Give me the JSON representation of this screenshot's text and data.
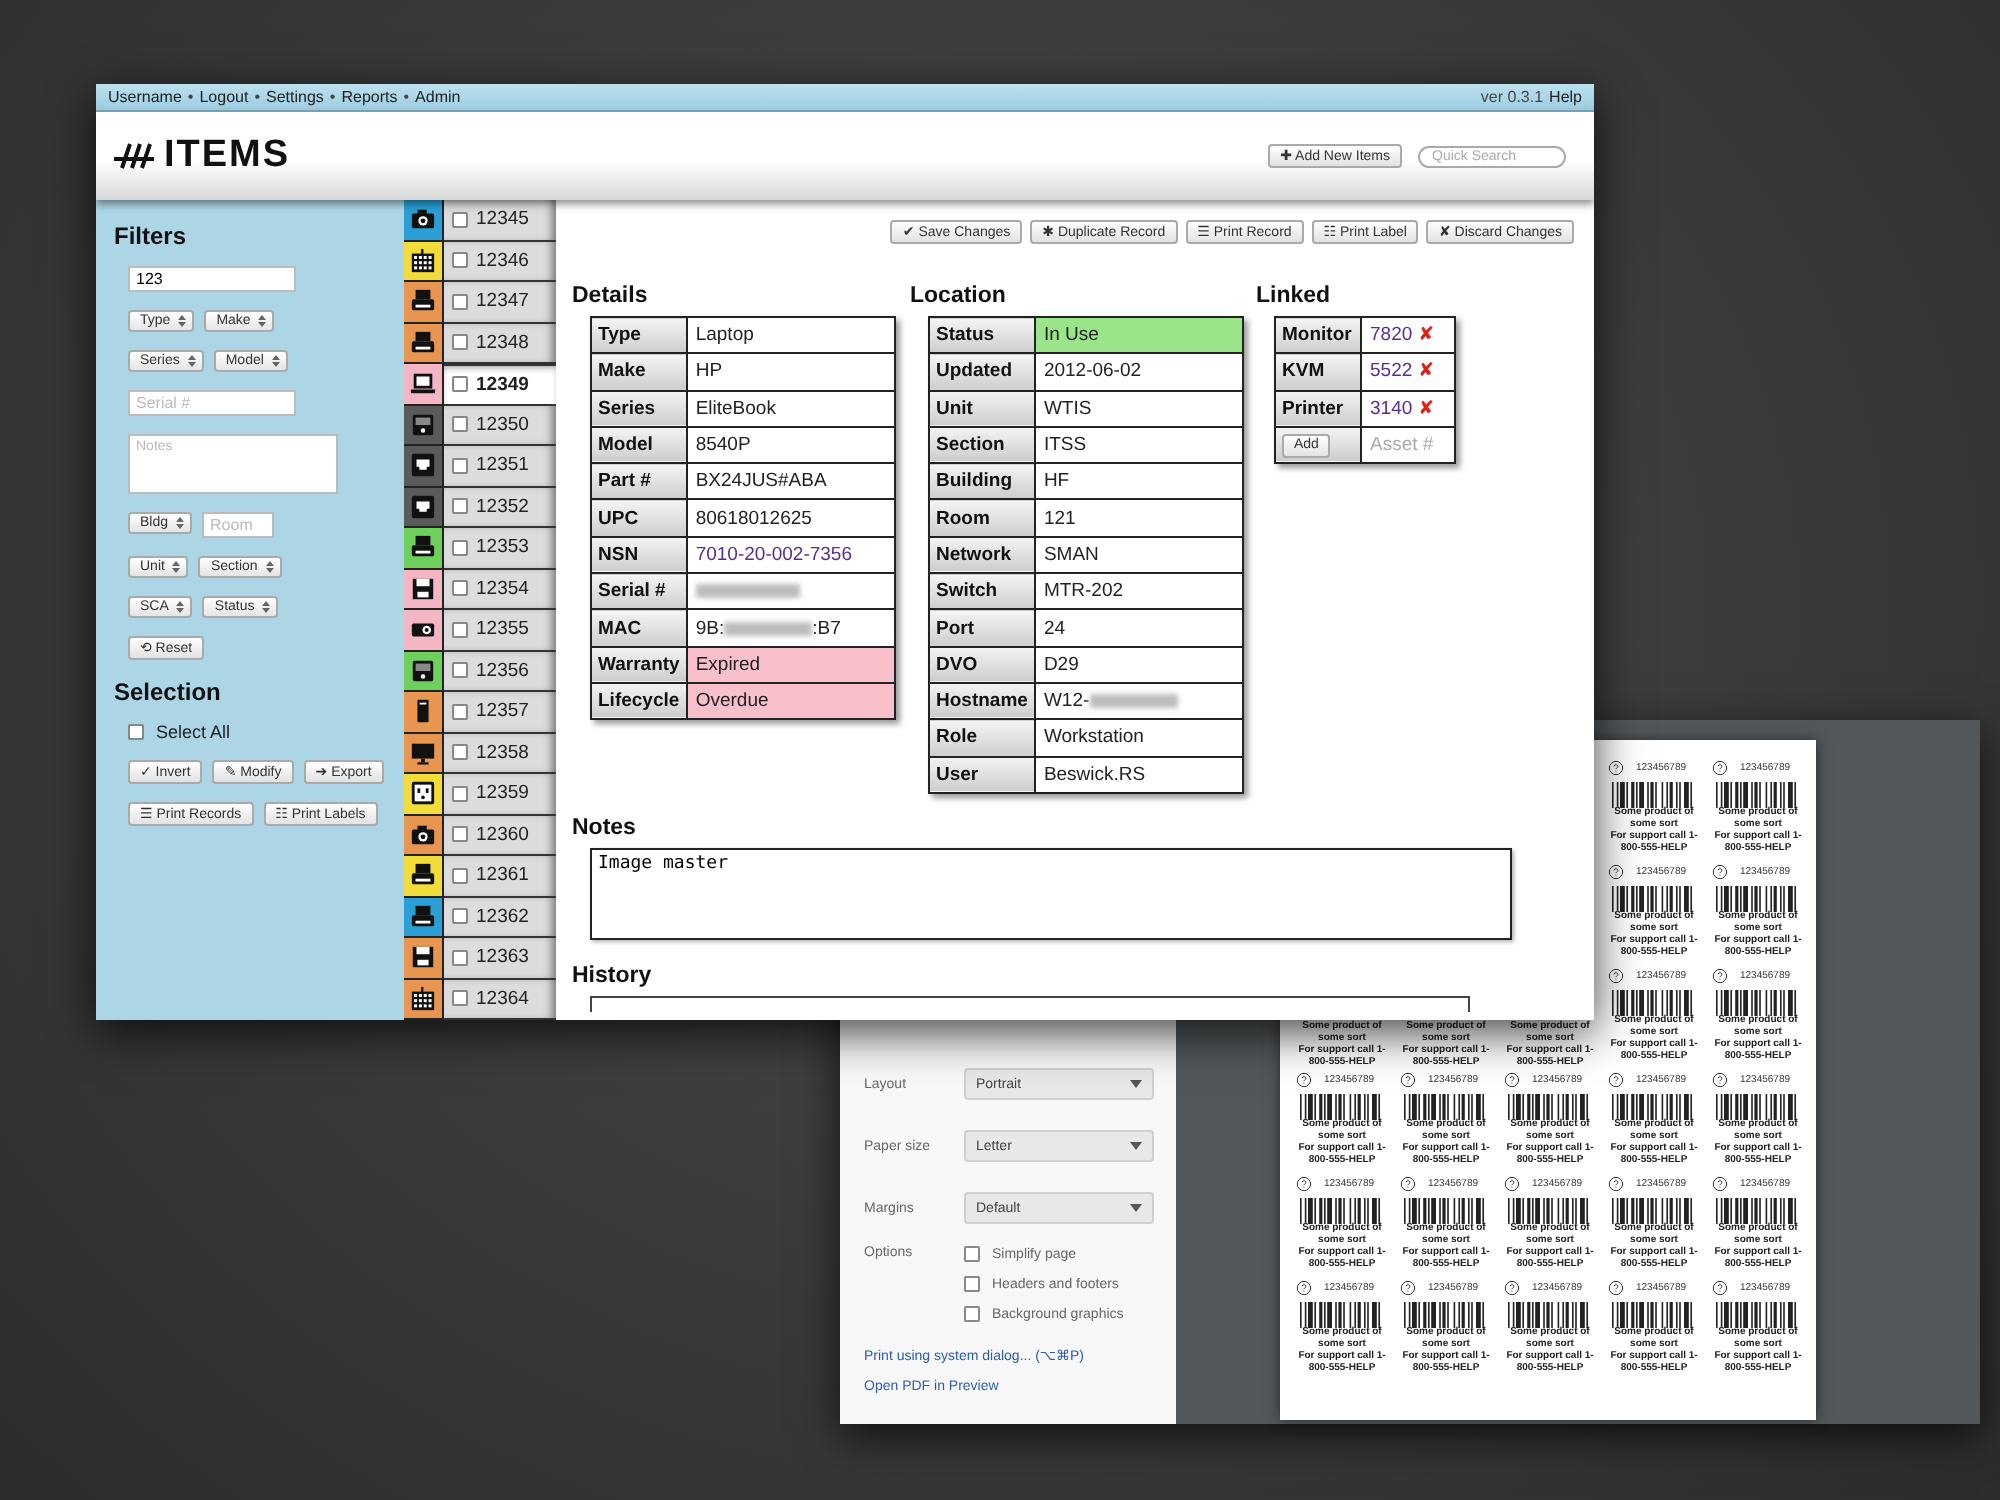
{
  "top_bar": {
    "nav": [
      {
        "kind": "link",
        "text": "Username"
      },
      {
        "kind": "separator",
        "text": "•"
      },
      {
        "kind": "link",
        "text": "Logout"
      },
      {
        "kind": "separator",
        "text": "•"
      },
      {
        "kind": "link",
        "text": "Settings"
      },
      {
        "kind": "separator",
        "text": "•"
      },
      {
        "kind": "link",
        "text": "Reports"
      },
      {
        "kind": "separator",
        "text": "•"
      },
      {
        "kind": "link",
        "text": "Admin"
      }
    ],
    "version": "ver 0.3.1",
    "help": "Help"
  },
  "header": {
    "logo": "ITEMS",
    "add_button": "✚ Add New Items",
    "search": {
      "placeholder": "Quick Search"
    }
  },
  "filters": {
    "title": "Filters",
    "rows": [
      [
        {
          "kind": "input",
          "value": "123"
        }
      ],
      [
        {
          "kind": "select",
          "label": "Type"
        },
        {
          "kind": "select",
          "label": "Make"
        }
      ],
      [
        {
          "kind": "select",
          "label": "Series"
        },
        {
          "kind": "select",
          "label": "Model"
        }
      ],
      [
        {
          "kind": "input",
          "placeholder": "Serial #"
        }
      ],
      [
        {
          "kind": "textarea",
          "placeholder": "Notes"
        }
      ],
      [
        {
          "kind": "select",
          "label": "Bldg"
        },
        {
          "kind": "input",
          "placeholder": "Room"
        }
      ],
      [
        {
          "kind": "select",
          "label": "Unit"
        },
        {
          "kind": "select",
          "label": "Section"
        }
      ],
      [
        {
          "kind": "select",
          "label": "SCA"
        },
        {
          "kind": "select",
          "label": "Status"
        }
      ],
      [
        {
          "kind": "button",
          "label": "⟲ Reset"
        }
      ]
    ]
  },
  "selection": {
    "title": "Selection",
    "select_all": {
      "label": "Select All",
      "checked": false
    },
    "button_rows": [
      [
        "✓ Invert",
        "✎ Modify",
        "➔ Export"
      ],
      [
        "☰ Print Records",
        "☷ Print Labels"
      ]
    ]
  },
  "items": [
    {
      "number": "12345",
      "kind": "camera",
      "color": "#2a9fd6",
      "selected": false,
      "checked": false
    },
    {
      "number": "12346",
      "kind": "keyboard",
      "color": "#f2dc3a",
      "selected": false,
      "checked": false
    },
    {
      "number": "12347",
      "kind": "printer",
      "color": "#e89550",
      "selected": false,
      "checked": false
    },
    {
      "number": "12348",
      "kind": "printer",
      "color": "#e89550",
      "selected": false,
      "checked": false
    },
    {
      "number": "12349",
      "kind": "laptop",
      "color": "#f4b6c2",
      "selected": true,
      "checked": false
    },
    {
      "number": "12350",
      "kind": "drive",
      "color": "#5a5a5a",
      "selected": false,
      "checked": false
    },
    {
      "number": "12351",
      "kind": "network",
      "color": "#5a5a5a",
      "selected": false,
      "checked": false
    },
    {
      "number": "12352",
      "kind": "network",
      "color": "#5a5a5a",
      "selected": false,
      "checked": false
    },
    {
      "number": "12353",
      "kind": "printer",
      "color": "#6fcf5c",
      "selected": false,
      "checked": false
    },
    {
      "number": "12354",
      "kind": "floppy",
      "color": "#f4b6c2",
      "selected": false,
      "checked": false
    },
    {
      "number": "12355",
      "kind": "projector",
      "color": "#f4b6c2",
      "selected": false,
      "checked": false
    },
    {
      "number": "12356",
      "kind": "drive",
      "color": "#6fcf5c",
      "selected": false,
      "checked": false
    },
    {
      "number": "12357",
      "kind": "tower",
      "color": "#e89550",
      "selected": false,
      "checked": false
    },
    {
      "number": "12358",
      "kind": "monitor",
      "color": "#e89550",
      "selected": false,
      "checked": false
    },
    {
      "number": "12359",
      "kind": "outlet",
      "color": "#f2dc3a",
      "selected": false,
      "checked": false
    },
    {
      "number": "12360",
      "kind": "camera",
      "color": "#e89550",
      "selected": false,
      "checked": false
    },
    {
      "number": "12361",
      "kind": "printer",
      "color": "#f2dc3a",
      "selected": false,
      "checked": false
    },
    {
      "number": "12362",
      "kind": "printer",
      "color": "#2a9fd6",
      "selected": false,
      "checked": false
    },
    {
      "number": "12363",
      "kind": "floppy",
      "color": "#e89550",
      "selected": false,
      "checked": false
    },
    {
      "number": "12364",
      "kind": "keyboard",
      "color": "#e89550",
      "selected": false,
      "checked": false
    }
  ],
  "actions": [
    "✔ Save Changes",
    "✱ Duplicate Record",
    "☰ Print Record",
    "☷ Print Label",
    "✘ Discard Changes"
  ],
  "details": {
    "title": "Details",
    "rows": [
      {
        "label": "Type",
        "kind": "text",
        "value": "Laptop",
        "color": "#ffffff"
      },
      {
        "label": "Make",
        "kind": "text",
        "value": "HP",
        "color": "#ffffff"
      },
      {
        "label": "Series",
        "kind": "text",
        "value": "EliteBook",
        "color": "#ffffff"
      },
      {
        "label": "Model",
        "kind": "text",
        "value": "8540P",
        "color": "#ffffff"
      },
      {
        "label": "Part #",
        "kind": "text",
        "value": "BX24JUS#ABA",
        "color": "#ffffff"
      },
      {
        "label": "UPC",
        "kind": "text",
        "value": "80618012625",
        "color": "#ffffff"
      },
      {
        "label": "NSN",
        "kind": "link",
        "value": "7010-20-002-7356",
        "color": "#ffffff"
      },
      {
        "label": "Serial #",
        "kind": "redacted",
        "color": "#ffffff"
      },
      {
        "label": "MAC",
        "kind": "redacted",
        "value": "9B:",
        "value_end": ":B7",
        "color": "#ffffff"
      },
      {
        "label": "Warranty",
        "kind": "text",
        "value": "Expired",
        "color": "#f7c0ca"
      },
      {
        "label": "Lifecycle",
        "kind": "text",
        "value": "Overdue",
        "color": "#f7c0ca"
      }
    ]
  },
  "location": {
    "title": "Location",
    "rows": [
      {
        "label": "Status",
        "kind": "text",
        "value": "In Use",
        "color": "#9ae58a"
      },
      {
        "label": "Updated",
        "kind": "text",
        "value": "2012-06-02",
        "color": "#ffffff"
      },
      {
        "label": "Unit",
        "kind": "text",
        "value": "WTIS",
        "color": "#ffffff"
      },
      {
        "label": "Section",
        "kind": "text",
        "value": "ITSS",
        "color": "#ffffff"
      },
      {
        "label": "Building",
        "kind": "text",
        "value": "HF",
        "color": "#ffffff"
      },
      {
        "label": "Room",
        "kind": "text",
        "value": "121",
        "color": "#ffffff"
      },
      {
        "label": "Network",
        "kind": "text",
        "value": "SMAN",
        "color": "#ffffff"
      },
      {
        "label": "Switch",
        "kind": "text",
        "value": "MTR-202",
        "color": "#ffffff"
      },
      {
        "label": "Port",
        "kind": "text",
        "value": "24",
        "color": "#ffffff"
      },
      {
        "label": "DVO",
        "kind": "text",
        "value": "D29",
        "color": "#ffffff"
      },
      {
        "label": "Hostname",
        "kind": "redacted",
        "value": "W12-",
        "color": "#ffffff"
      },
      {
        "label": "Role",
        "kind": "text",
        "value": "Workstation",
        "color": "#ffffff"
      },
      {
        "label": "User",
        "kind": "text",
        "value": "Beswick.RS",
        "color": "#ffffff"
      }
    ]
  },
  "linked": {
    "title": "Linked",
    "rows": [
      {
        "label": "Monitor",
        "value": "7820",
        "remove": "✘"
      },
      {
        "label": "KVM",
        "value": "5522",
        "remove": "✘"
      },
      {
        "label": "Printer",
        "value": "3140",
        "remove": "✘"
      }
    ],
    "add_button": "Add",
    "asset": {
      "placeholder": "Asset #"
    }
  },
  "notes": {
    "title": "Notes",
    "value": "Image master"
  },
  "history": {
    "title": "History"
  },
  "print_dialog": {
    "settings": [
      {
        "label": "Layout",
        "value": "Portrait"
      },
      {
        "label": "Paper size",
        "value": "Letter"
      },
      {
        "label": "Margins",
        "value": "Default"
      }
    ],
    "options": {
      "label": "Options",
      "items": [
        {
          "label": "Simplify page",
          "checked": false
        },
        {
          "label": "Headers and footers",
          "checked": false
        },
        {
          "label": "Background graphics",
          "checked": false
        }
      ]
    },
    "links": [
      "Print using system dialog... (⌥⌘P)",
      "Open PDF in Preview"
    ],
    "label_rows": [
      {
        "labels": [
          {
            "number": "123456789",
            "product": "Some product of some sort",
            "support": "For support call 1-800-555-HELP"
          },
          {
            "number": "123456789",
            "product": "Some product of some sort",
            "support": "For support call 1-800-555-HELP"
          }
        ]
      },
      {
        "labels": [
          {
            "number": "123456789",
            "product": "Some product of some sort",
            "support": "For support call 1-800-555-HELP"
          },
          {
            "number": "123456789",
            "product": "Some product of some sort",
            "support": "For support call 1-800-555-HELP"
          }
        ]
      },
      {
        "labels": [
          {
            "product": "Some product of some sort",
            "support": "For support call 1-800-555-HELP"
          },
          {
            "product": "Some product of some sort",
            "support": "For support call 1-800-555-HELP"
          },
          {
            "product": "Some product of some sort",
            "support": "For support call 1-800-555-HELP"
          },
          {
            "number": "123456789",
            "product": "Some product of some sort",
            "support": "For support call 1-800-555-HELP"
          },
          {
            "number": "123456789",
            "product": "Some product of some sort",
            "support": "For support call 1-800-555-HELP"
          }
        ]
      },
      {
        "labels": [
          {
            "number": "123456789",
            "product": "Some product of some sort",
            "support": "For support call 1-800-555-HELP"
          },
          {
            "number": "123456789",
            "product": "Some product of some sort",
            "support": "For support call 1-800-555-HELP"
          },
          {
            "number": "123456789",
            "product": "Some product of some sort",
            "support": "For support call 1-800-555-HELP"
          },
          {
            "number": "123456789",
            "product": "Some product of some sort",
            "support": "For support call 1-800-555-HELP"
          },
          {
            "number": "123456789",
            "product": "Some product of some sort",
            "support": "For support call 1-800-555-HELP"
          }
        ]
      },
      {
        "labels": [
          {
            "number": "123456789",
            "product": "Some product of some sort",
            "support": "For support call 1-800-555-HELP"
          },
          {
            "number": "123456789",
            "product": "Some product of some sort",
            "support": "For support call 1-800-555-HELP"
          },
          {
            "number": "123456789",
            "product": "Some product of some sort",
            "support": "For support call 1-800-555-HELP"
          },
          {
            "number": "123456789",
            "product": "Some product of some sort",
            "support": "For support call 1-800-555-HELP"
          },
          {
            "number": "123456789",
            "product": "Some product of some sort",
            "support": "For support call 1-800-555-HELP"
          }
        ]
      },
      {
        "labels": [
          {
            "number": "123456789",
            "product": "Some product of some sort",
            "support": "For support call 1-800-555-HELP"
          },
          {
            "number": "123456789",
            "product": "Some product of some sort",
            "support": "For support call 1-800-555-HELP"
          },
          {
            "number": "123456789",
            "product": "Some product of some sort",
            "support": "For support call 1-800-555-HELP"
          },
          {
            "number": "123456789",
            "product": "Some product of some sort",
            "support": "For support call 1-800-555-HELP"
          },
          {
            "number": "123456789",
            "product": "Some product of some sort",
            "support": "For support call 1-800-555-HELP"
          }
        ]
      }
    ]
  }
}
